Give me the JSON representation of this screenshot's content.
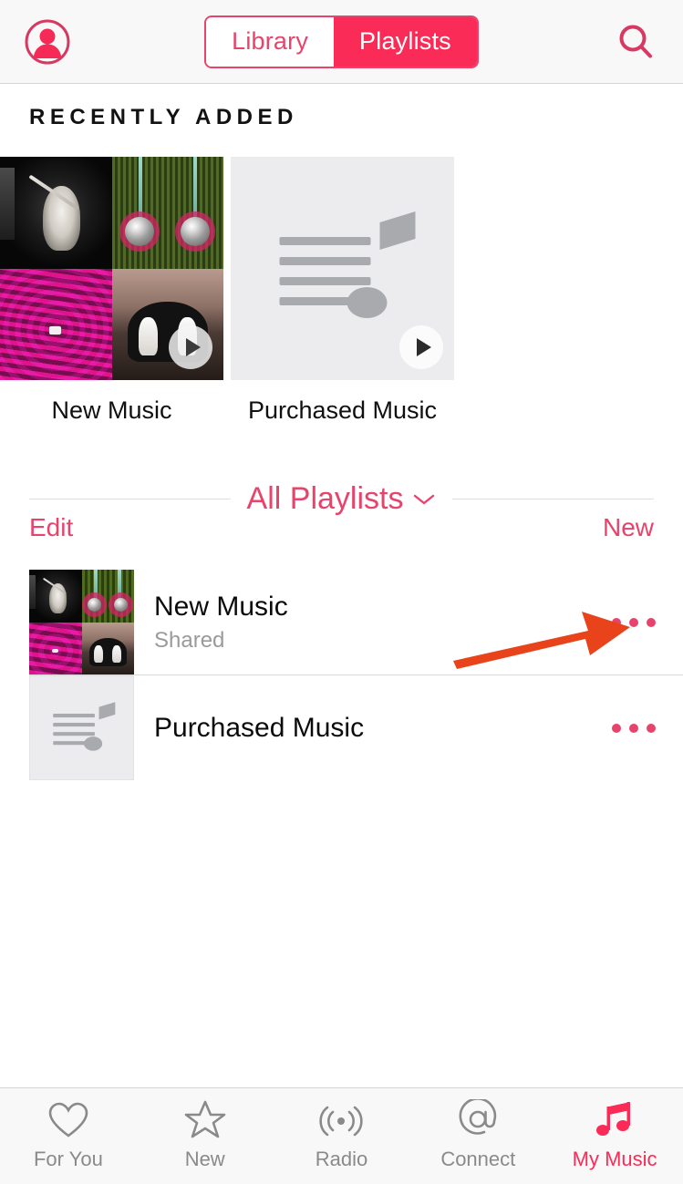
{
  "app": {
    "accent": "#fa2b56",
    "accent_text": "#e8436b",
    "annotation_color": "#e8431a"
  },
  "navbar": {
    "profile_icon": "person-circle-icon",
    "search_icon": "search-icon",
    "segments": [
      {
        "label": "Library",
        "active": false
      },
      {
        "label": "Playlists",
        "active": true
      }
    ]
  },
  "recently_added": {
    "heading": "RECENTLY ADDED",
    "tiles": [
      {
        "label": "New Music",
        "art": "mosaic",
        "play_button": true
      },
      {
        "label": "Purchased Music",
        "art": "placeholder-note",
        "play_button": true
      }
    ]
  },
  "playlists_section": {
    "title": "All Playlists",
    "chevron_icon": "chevron-down-icon",
    "edit_label": "Edit",
    "new_label": "New",
    "rows": [
      {
        "title": "New Music",
        "subtitle": "Shared",
        "thumb": "mosaic",
        "more_icon": "more-dots-icon"
      },
      {
        "title": "Purchased Music",
        "subtitle": "",
        "thumb": "placeholder-note",
        "more_icon": "more-dots-icon"
      }
    ]
  },
  "annotation": {
    "type": "arrow",
    "points_to": "New Music row more button"
  },
  "tabbar": {
    "tabs": [
      {
        "label": "For You",
        "icon": "heart-icon",
        "active": false
      },
      {
        "label": "New",
        "icon": "star-icon",
        "active": false
      },
      {
        "label": "Radio",
        "icon": "radio-waves-icon",
        "active": false
      },
      {
        "label": "Connect",
        "icon": "at-circle-icon",
        "active": false
      },
      {
        "label": "My Music",
        "icon": "music-notes-icon",
        "active": true
      }
    ]
  }
}
